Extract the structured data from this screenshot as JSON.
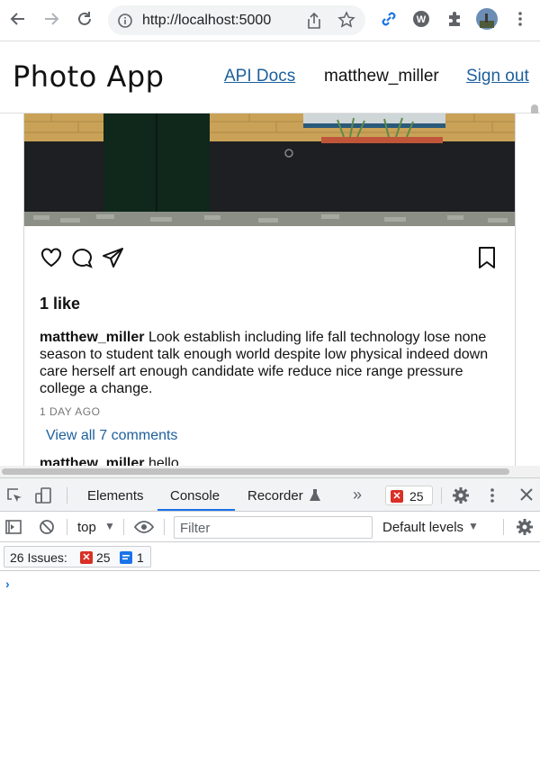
{
  "browser": {
    "url": "http://localhost:5000"
  },
  "app": {
    "logo": "Photo App",
    "nav": {
      "api_docs": "API Docs",
      "username": "matthew_miller",
      "sign_out": "Sign out"
    }
  },
  "post": {
    "likes": "1 like",
    "author": "matthew_miller",
    "caption": "Look establish including life fall technology lose none season to student talk enough world despite low physical indeed down care herself art enough candidate wife reduce nice range pressure college a change.",
    "time_ago": "1 DAY AGO",
    "view_comments": "View all 7 comments",
    "comment_author": "matthew_miller",
    "comment_text": "hello"
  },
  "devtools": {
    "tabs": [
      "Elements",
      "Console",
      "Recorder"
    ],
    "active_tab": "Console",
    "more": "»",
    "error_count": "25",
    "context": "top",
    "filter_placeholder": "Filter",
    "levels": "Default levels",
    "issues_label": "26 Issues:",
    "issues_errors": "25",
    "issues_info": "1",
    "prompt": "›"
  },
  "colors": {
    "link": "#1d5f9c",
    "devtools_accent": "#1a73e8",
    "error": "#d93025"
  }
}
